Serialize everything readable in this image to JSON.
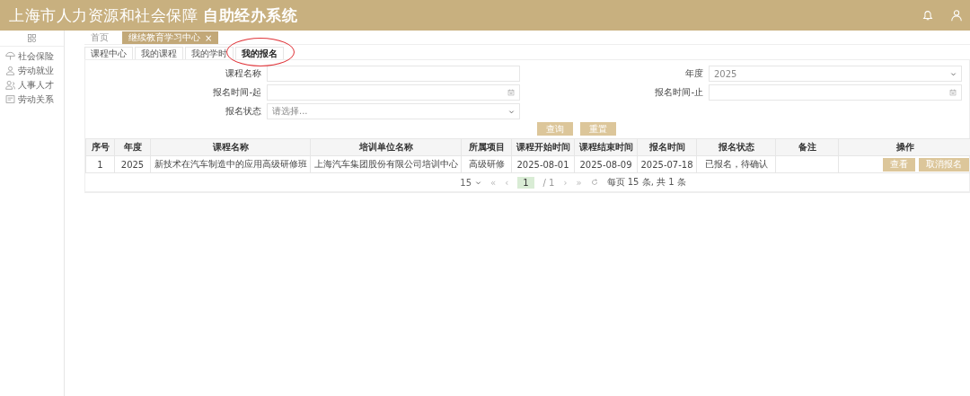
{
  "header": {
    "title_regular": "上海市人力资源和社会保障",
    "title_bold": "自助经办系统"
  },
  "sidebar": {
    "items": [
      {
        "label": "社会保险"
      },
      {
        "label": "劳动就业"
      },
      {
        "label": "人事人才"
      },
      {
        "label": "劳动关系"
      }
    ]
  },
  "page_tabs": [
    {
      "label": "首页",
      "selected": false,
      "closable": false
    },
    {
      "label": "继续教育学习中心",
      "selected": true,
      "closable": true,
      "close": "×"
    }
  ],
  "sub_tabs": [
    {
      "label": "课程中心",
      "selected": false,
      "circled": false
    },
    {
      "label": "我的课程",
      "selected": false,
      "circled": false
    },
    {
      "label": "我的学时",
      "selected": false,
      "circled": false
    },
    {
      "label": "我的报名",
      "selected": true,
      "circled": true
    }
  ],
  "form": {
    "left": [
      {
        "label": "课程名称",
        "kind": "text"
      },
      {
        "label": "报名时间-起",
        "kind": "date"
      },
      {
        "label": "报名状态",
        "kind": "select",
        "placeholder": "请选择..."
      }
    ],
    "right": [
      {
        "label": "年度",
        "kind": "select",
        "value": "2025"
      },
      {
        "label": "报名时间-止",
        "kind": "date"
      }
    ],
    "buttons": [
      "查询",
      "重置"
    ]
  },
  "table": {
    "columns": [
      "序号",
      "年度",
      "课程名称",
      "培训单位名称",
      "所属项目",
      "课程开始时间",
      "课程结束时间",
      "报名时间",
      "报名状态",
      "备注",
      "操作"
    ],
    "rows": [
      {
        "cells": [
          "1",
          "2025",
          "新技术在汽车制造中的应用高级研修班",
          "上海汽车集团股份有限公司培训中心",
          "高级研修",
          "2025-08-01",
          "2025-08-09",
          "2025-07-18",
          "已报名，待确认",
          ""
        ],
        "actions": [
          "查看",
          "取消报名"
        ]
      }
    ]
  },
  "pager": {
    "page_size": "15",
    "first": "«",
    "prev": "‹",
    "page": "1",
    "total_pages": "/ 1",
    "next": "›",
    "last": "»",
    "summary": "每页 15 条, 共 1 条"
  }
}
